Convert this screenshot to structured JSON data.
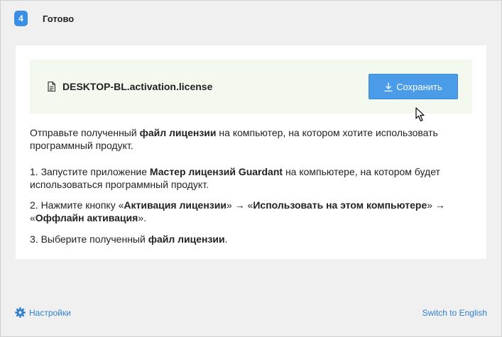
{
  "step": {
    "number": "4",
    "title": "Готово"
  },
  "file": {
    "name": "DESKTOP-BL.activation.license",
    "icon": "document-icon",
    "save_label": "Сохранить",
    "save_icon": "download-icon"
  },
  "instructions": {
    "intro_pre": "Отправьте полученный ",
    "intro_bold": "файл лицензии",
    "intro_post": " на компьютер, на котором хотите использовать программный продукт.",
    "step1_pre": "1. Запустите приложение ",
    "step1_bold": "Мастер лицензий Guardant",
    "step1_post": " на компьютере, на котором будет использоваться программный продукт.",
    "step2_pre": "2. Нажмите кнопку «",
    "step2_bold1": "Активация лицензии",
    "step2_mid1": "» → «",
    "step2_bold2": "Использовать на этом компьютере",
    "step2_mid2": "» → «",
    "step2_bold3": "Оффлайн активация",
    "step2_post": "».",
    "step3_pre": "3. Выберите полученный ",
    "step3_bold": "файл лицензии",
    "step3_post": "."
  },
  "footer": {
    "settings_label": "Настройки",
    "settings_icon": "gear-icon",
    "language_label": "Switch to English"
  },
  "colors": {
    "accent": "#3a8ee6",
    "button": "#4a9be8",
    "link": "#2f7fd0",
    "file_box_bg": "#f3f9ef",
    "page_bg": "#f0f0f0"
  }
}
